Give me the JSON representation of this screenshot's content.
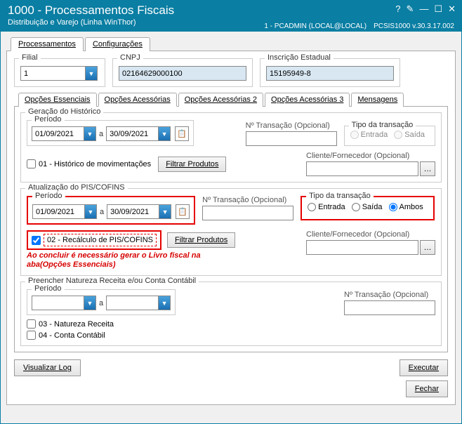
{
  "window": {
    "title": "1000 - Processamentos Fiscais",
    "subtitle": "Distribuição e Varejo (Linha WinThor)",
    "user": "1 - PCADMIN (LOCAL@LOCAL)",
    "appver": "PCSIS1000  v.30.3.17.002",
    "btn_help": "?",
    "btn_edit": "✎",
    "btn_min": "—",
    "btn_max": "☐",
    "btn_close": "✕"
  },
  "tabs": {
    "processamentos": "Processamentos",
    "configuracoes": "Configurações"
  },
  "header": {
    "filial_label": "Filial",
    "filial_value": "1",
    "cnpj_label": "CNPJ",
    "cnpj_value": "02164629000100",
    "ie_label": "Inscrição Estadual",
    "ie_value": "15195949-8"
  },
  "subtabs": {
    "essenciais": "Opções Essenciais",
    "acess": "Opções Acessórias",
    "acess2": "Opções Acessórias 2",
    "acess3": "Opções Acessórias 3",
    "msg": "Mensagens"
  },
  "labels": {
    "ger_hist": "Geração do Histórico",
    "periodo": "Período",
    "a": "a",
    "num_trans": "Nº Transação (Opcional)",
    "tipo_trans": "Tipo da transação",
    "entrada": "Entrada",
    "saida": "Saída",
    "ambos": "Ambos",
    "cliforn": "Cliente/Fornecedor (Opcional)",
    "filtrar": "Filtrar Produtos",
    "chk01": "01 - Histórico de movimentações",
    "atu_pis": "Atualização do PIS/COFINS",
    "chk02": "02 - Recálculo de PIS/COFINS",
    "warn1": "Ao concluir é necessário gerar o Livro fiscal na",
    "warn2": "aba(Opções Essenciais)",
    "preencher": "Preencher Natureza Receita e/ou Conta Contábil",
    "chk03": "03 - Natureza Receita",
    "chk04": "04 - Conta Contábil",
    "visualizar": "Visualizar Log",
    "executar": "Executar",
    "fechar": "Fechar"
  },
  "ger_hist": {
    "de": "01/09/2021",
    "ate": "30/09/2021"
  },
  "pis": {
    "de": "01/09/2021",
    "ate": "30/09/2021",
    "tipo": "ambos"
  }
}
